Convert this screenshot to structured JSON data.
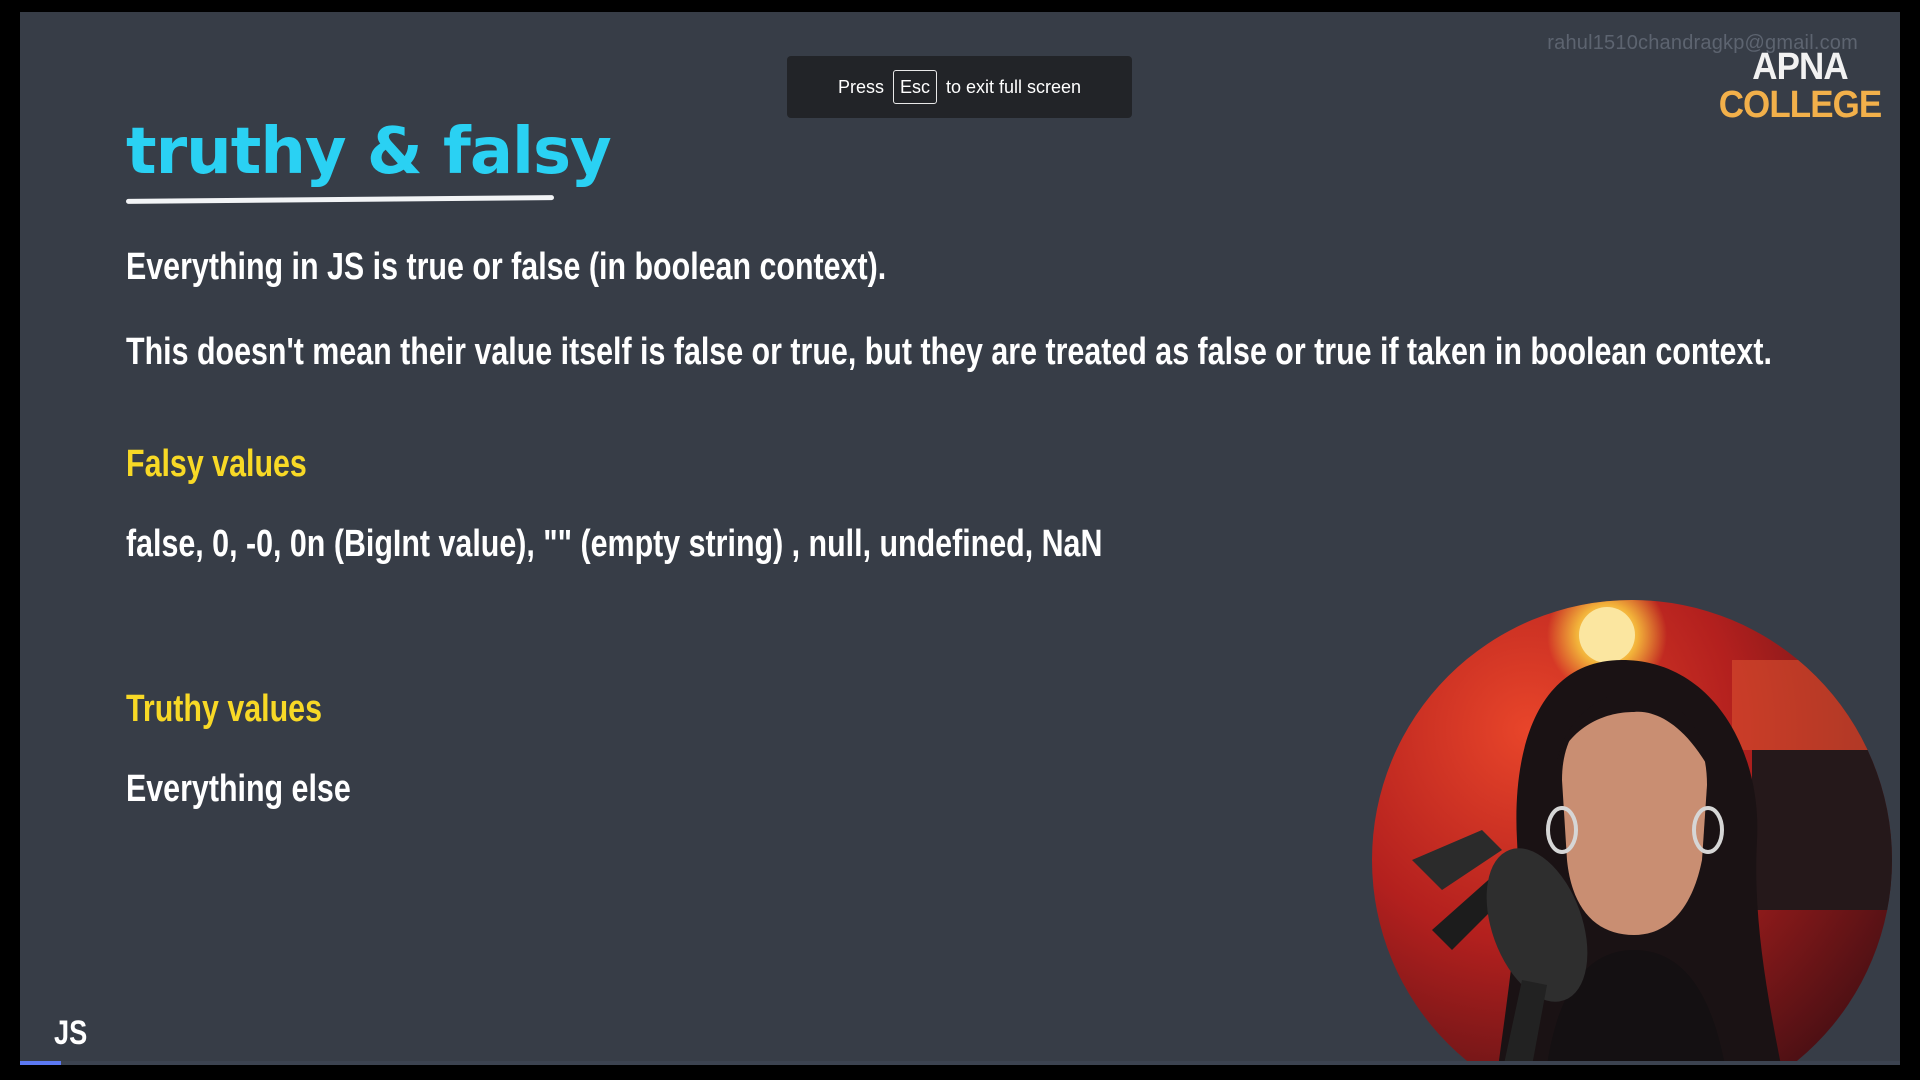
{
  "slide": {
    "title": "truthy & falsy",
    "line1": "Everything in JS is true or false (in boolean context).",
    "line2": "This doesn't mean their value itself is false or true, but they are treated as false or true if taken in boolean context.",
    "falsy_heading": "Falsy values",
    "falsy_values": "false,  0,  -0,  0n (BigInt value),  \"\" (empty string) ,  null,  undefined,  NaN",
    "truthy_heading": "Truthy values",
    "truthy_values": "Everything else",
    "tag": "JS"
  },
  "overlay": {
    "press": "Press",
    "key": "Esc",
    "rest": "to exit full screen"
  },
  "watermark": {
    "email": "rahul1510chandragkp@gmail.com",
    "logo_line1": "APNA",
    "logo_line2": "COLLEGE"
  },
  "video": {
    "progress": 0.022
  },
  "colors": {
    "background": "#373d47",
    "title": "#2ad1f3",
    "heading": "#f8d926",
    "text": "#ffffff",
    "logo_accent": "#f2b04a",
    "progress": "#5b78f2"
  }
}
